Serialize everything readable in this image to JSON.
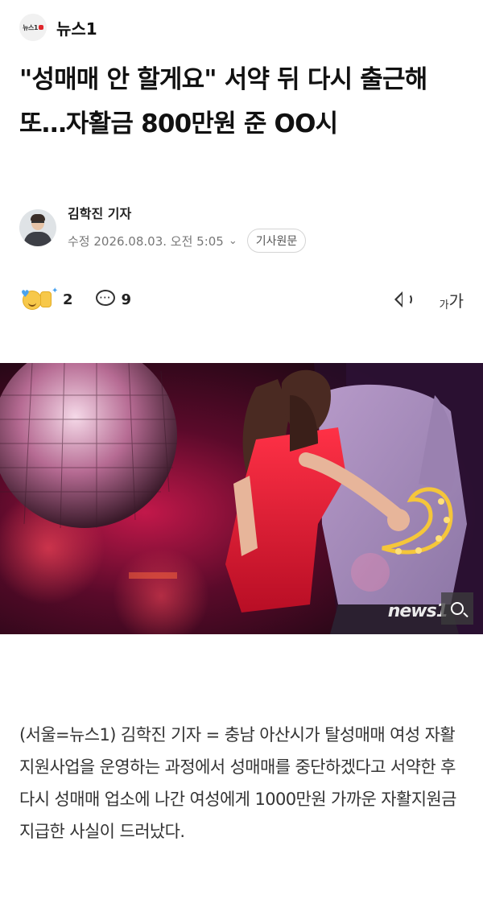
{
  "header": {
    "logo_text": "뉴스1",
    "press_name": "뉴스1"
  },
  "headline": "\"성매매 안 할게요\" 서약 뒤 다시 출근해 또…자활금 800만원 준 OO시",
  "byline": {
    "reporter": "김학진 기자",
    "edit_date": "수정 2026.08.03. 오전 5:05",
    "original_label": "기사원문"
  },
  "actions": {
    "reaction_count": "2",
    "comment_count": "9",
    "font_small": "가",
    "font_big": "가"
  },
  "image": {
    "watermark": "news1"
  },
  "body": {
    "paragraph": "(서울=뉴스1) 김학진 기자 = 충남 아산시가 탈성매매 여성 자활지원사업을 운영하는 과정에서 성매매를 중단하겠다고 서약한 후 다시 성매매 업소에 나간 여성에게 1000만원 가까운 자활지원금 지급한 사실이 드러났다."
  },
  "colors": {
    "brand_red": "#e0262b",
    "text_primary": "#111111",
    "text_secondary": "#777777"
  }
}
